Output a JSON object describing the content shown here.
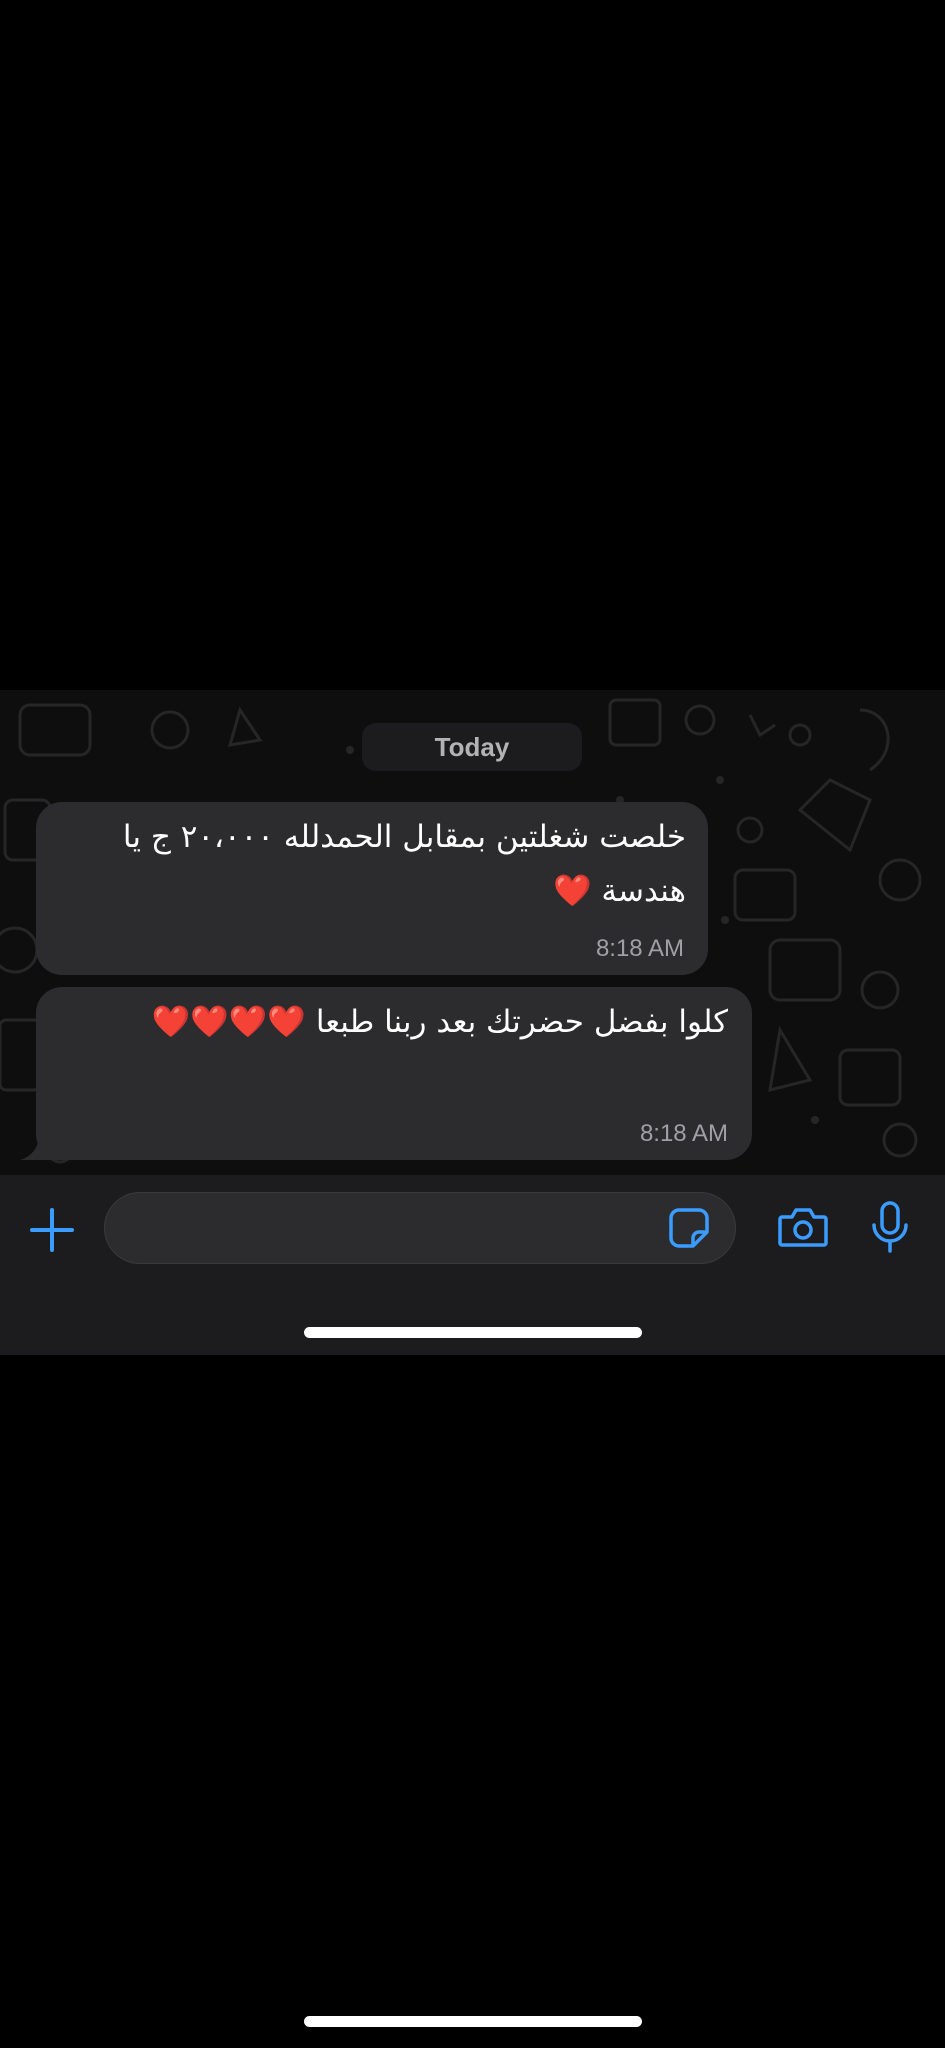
{
  "chat": {
    "date_label": "Today",
    "messages": [
      {
        "text": "خلصت شغلتين بمقابل الحمدلله ٢٠،٠٠٠ ج يا هندسة",
        "emoji": "❤️",
        "time": "8:18 AM"
      },
      {
        "text": "كلوا بفضل حضرتك بعد ربنا طبعا",
        "emoji": "❤️❤️❤️❤️",
        "time": "8:18 AM"
      }
    ]
  },
  "input_bar": {
    "placeholder": "",
    "icons": [
      "plus-icon",
      "sticker-icon",
      "camera-icon",
      "microphone-icon"
    ],
    "accent_color": "#3b9cff"
  },
  "colors": {
    "background": "#000000",
    "bubble": "#2c2c2e",
    "input_bar": "#1c1c1e",
    "heart": "#e8202a"
  }
}
